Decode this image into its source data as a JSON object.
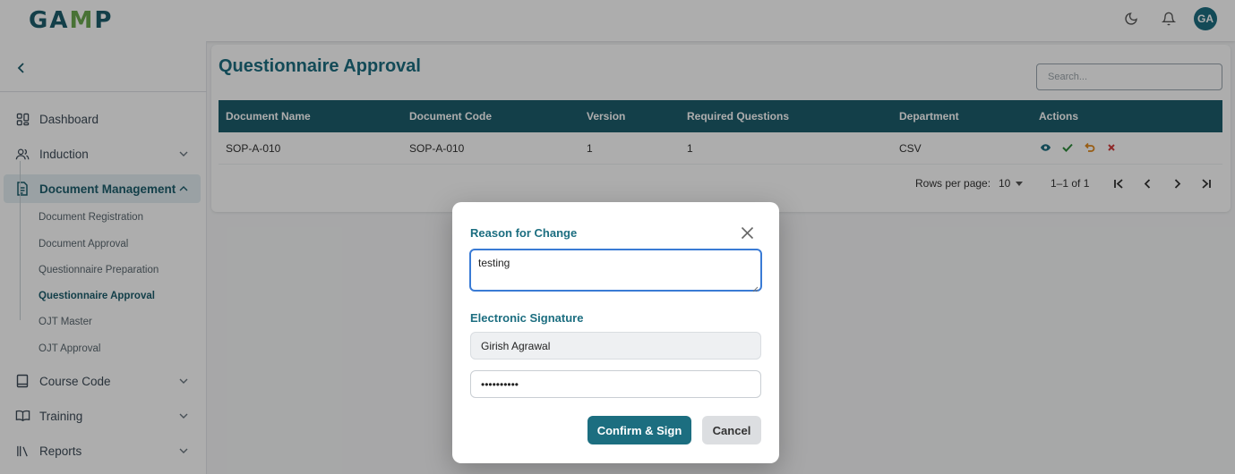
{
  "header": {
    "logo_text": "GAMP",
    "logo_prefix": "GA",
    "logo_leaf": "M",
    "logo_suffix": "P",
    "icons": [
      "moon-icon",
      "bell-icon"
    ],
    "avatar_initials": "GA",
    "brand_color": "#1c5d6c"
  },
  "sidebar": {
    "items": [
      {
        "label": "Dashboard",
        "icon": "grid-icon",
        "expandable": false
      },
      {
        "label": "Induction",
        "icon": "users-icon",
        "expandable": true
      },
      {
        "label": "Document Management",
        "icon": "document-icon",
        "expandable": true,
        "active": true
      },
      {
        "label": "Course Code",
        "icon": "book-icon",
        "expandable": true
      },
      {
        "label": "Training",
        "icon": "open-book-icon",
        "expandable": true
      },
      {
        "label": "Reports",
        "icon": "library-icon",
        "expandable": true
      }
    ],
    "submenu": [
      "Document Registration",
      "Document Approval",
      "Questionnaire Preparation",
      "Questionnaire Approval",
      "OJT Master",
      "OJT Approval"
    ],
    "current_submenu": "Questionnaire Approval"
  },
  "main": {
    "title": "Questionnaire Approval",
    "search_placeholder": "Search...",
    "table": {
      "columns": [
        "Document Name",
        "Document Code",
        "Version",
        "Required Questions",
        "Department",
        "Actions"
      ],
      "rows": [
        {
          "document_name": "SOP-A-010",
          "document_code": "SOP-A-010",
          "version": "1",
          "required_questions": "1",
          "department": "CSV",
          "actions": [
            "eye-icon",
            "check-icon",
            "undo-icon",
            "close-icon"
          ]
        }
      ]
    },
    "pagination": {
      "rows_per_page_label": "Rows per page:",
      "rows_per_page_value": "10",
      "range": "1–1 of 1"
    }
  },
  "modal": {
    "reason_label": "Reason for Change",
    "reason_value": "testing",
    "signature_label": "Electronic Signature",
    "signer_name": "Girish Agrawal",
    "password_value": "••••••••••",
    "confirm_label": "Confirm & Sign",
    "cancel_label": "Cancel"
  }
}
